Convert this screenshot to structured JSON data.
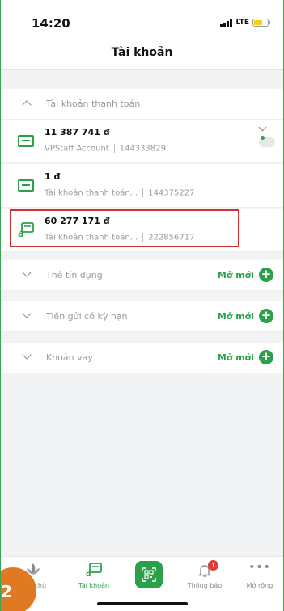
{
  "status_bar": {
    "time": "14:20",
    "network": "LTE"
  },
  "header": {
    "title": "Tài khoản"
  },
  "sections": {
    "payment": {
      "label": "Tài khoản thanh toán"
    },
    "credit": {
      "label": "Thẻ tín dụng",
      "action": "Mở mới"
    },
    "deposit": {
      "label": "Tiền gửi có kỳ hạn",
      "action": "Mở mới"
    },
    "loan": {
      "label": "Khoản vay",
      "action": "Mở mới"
    }
  },
  "accounts": [
    {
      "balance": "11 387 741  đ",
      "name": "VPStaff Account",
      "number": "144333829"
    },
    {
      "balance": "1  đ",
      "name": "Tài khoản thanh toán...",
      "number": "144375227"
    },
    {
      "balance": "60 277 171  đ",
      "name": "Tài khoản thanh toán...",
      "number": "222856717"
    }
  ],
  "tabbar": {
    "home": "ang chủ",
    "accounts": "Tài khoản",
    "notifications": "Thông báo",
    "more": "Mở rộng",
    "notification_count": "1"
  },
  "step_marker": "2",
  "colors": {
    "brand": "#2aa04a",
    "highlight": "#d92c2c",
    "marker": "#e07a22"
  }
}
